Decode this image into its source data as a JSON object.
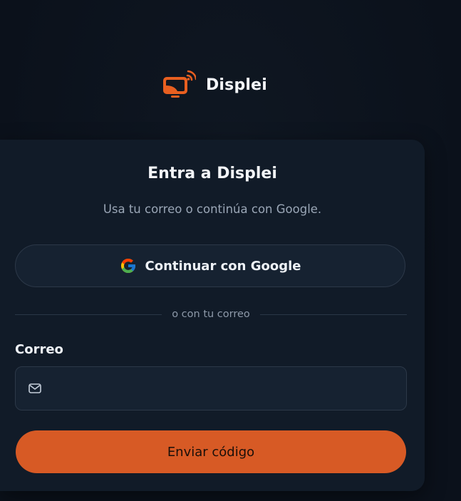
{
  "brand": {
    "name": "Displei",
    "accent_color": "#e85f20"
  },
  "card": {
    "title": "Entra a Displei",
    "subtitle": "Usa tu correo o continúa con Google."
  },
  "google_button": {
    "label": "Continuar con Google",
    "icon": "google-icon"
  },
  "divider": {
    "text": "o con tu correo"
  },
  "email": {
    "label": "Correo",
    "value": "",
    "placeholder": "",
    "icon": "mail-icon"
  },
  "submit_button": {
    "label": "Enviar código",
    "color": "#d75a25"
  }
}
